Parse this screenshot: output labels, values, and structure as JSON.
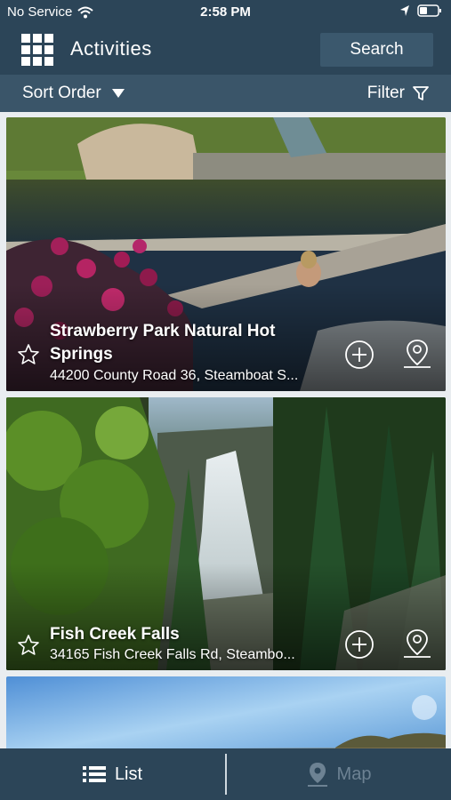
{
  "status_bar": {
    "carrier": "No Service",
    "time": "2:58 PM"
  },
  "header": {
    "title": "Activities",
    "search_label": "Search"
  },
  "toolbar": {
    "sort_label": "Sort Order",
    "filter_label": "Filter"
  },
  "activities": [
    {
      "name": "Strawberry Park Natural Hot Springs",
      "address": "44200 County Road 36, Steamboat S..."
    },
    {
      "name": "Fish Creek Falls",
      "address": "34165 Fish Creek Falls Rd, Steambo..."
    }
  ],
  "tabs": {
    "list_label": "List",
    "map_label": "Map"
  },
  "colors": {
    "header_bg": "#2c4558",
    "sort_bar_bg": "#3a5569",
    "tab_inactive": "#6d8293"
  },
  "icons": [
    "wifi-icon",
    "location-arrow-icon",
    "battery-icon",
    "grid-menu-icon",
    "caret-down-icon",
    "filter-funnel-icon",
    "star-icon",
    "plus-circle-icon",
    "map-pin-icon",
    "list-icon"
  ]
}
